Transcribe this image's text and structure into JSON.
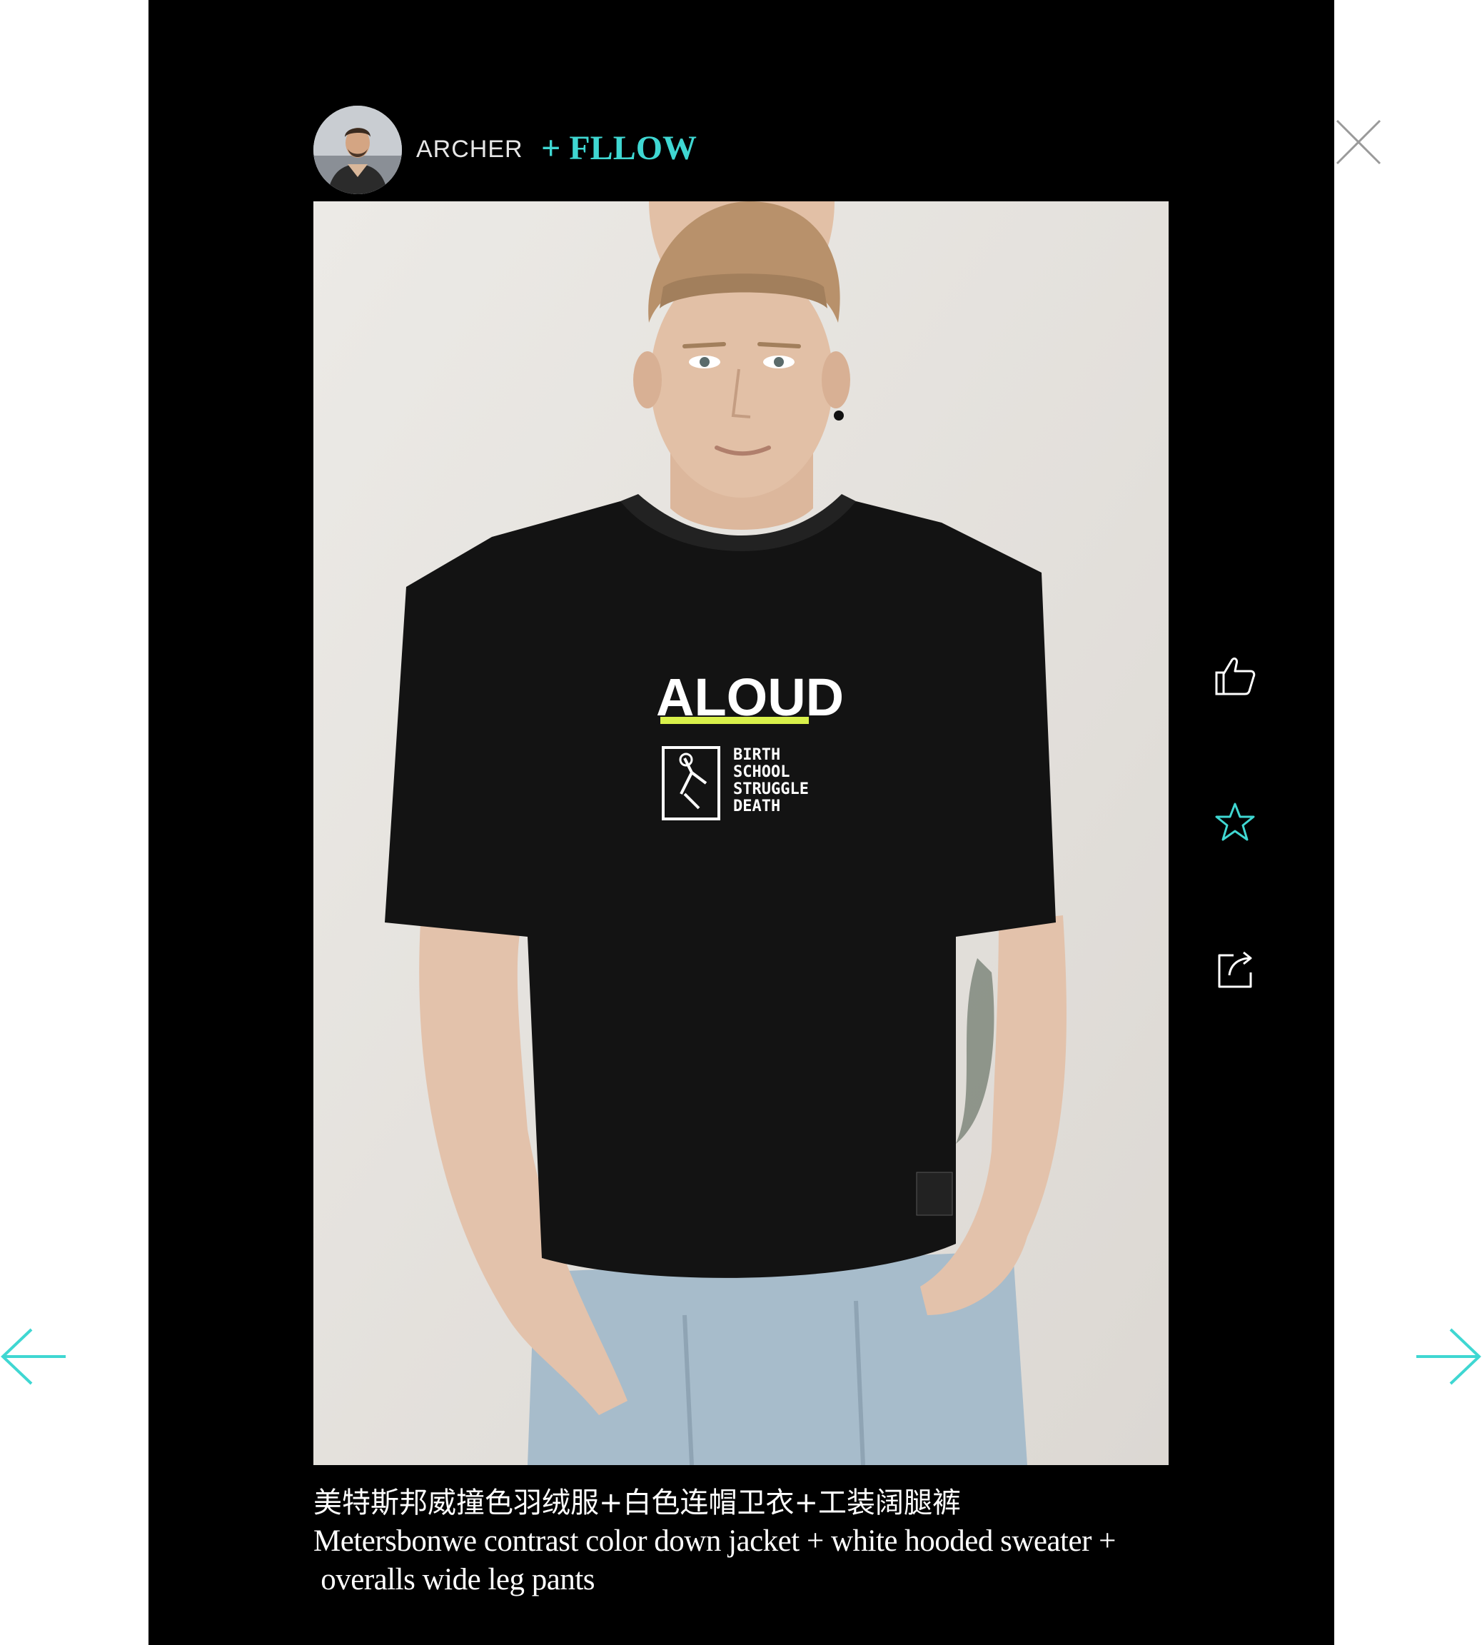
{
  "header": {
    "username": "ARCHER",
    "follow_label": "+ FLLOW"
  },
  "icons": {
    "close": "close-icon",
    "like": "thumbs-up-icon",
    "favorite": "star-icon",
    "share": "share-icon",
    "prev": "arrow-left-icon",
    "next": "arrow-right-icon"
  },
  "photo": {
    "shirt_print_title": "ALOUD",
    "shirt_print_list": [
      "BIRTH",
      "SCHOOL",
      "STRUGGLE",
      "DEATH"
    ]
  },
  "caption": {
    "zh": "美特斯邦威撞色羽绒服+白色连帽卫衣+工装阔腿裤",
    "en_line1": "Metersbonwe contrast color down jacket + white hooded sweater +",
    "en_line2": " overalls wide leg pants"
  },
  "colors": {
    "accent": "#3fd7d2",
    "panel": "#000000",
    "page": "#ffffff"
  }
}
